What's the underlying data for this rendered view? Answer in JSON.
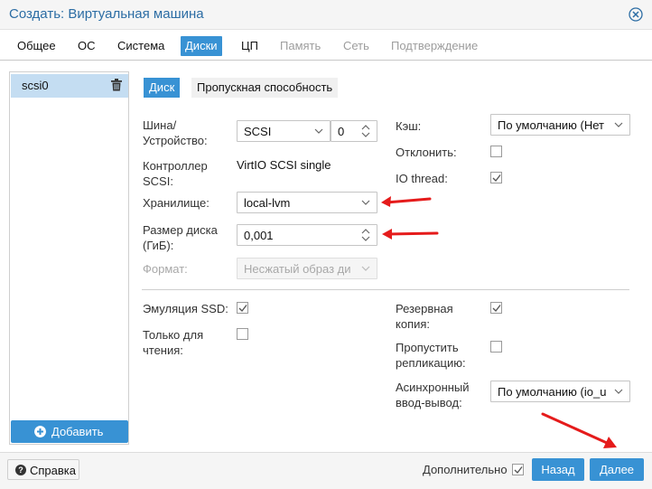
{
  "window": {
    "title": "Создать: Виртуальная машина"
  },
  "tabs": [
    {
      "label": "Общее",
      "state": "normal"
    },
    {
      "label": "ОС",
      "state": "normal"
    },
    {
      "label": "Система",
      "state": "normal"
    },
    {
      "label": "Диски",
      "state": "active"
    },
    {
      "label": "ЦП",
      "state": "normal"
    },
    {
      "label": "Память",
      "state": "disabled"
    },
    {
      "label": "Сеть",
      "state": "disabled"
    },
    {
      "label": "Подтверждение",
      "state": "disabled"
    }
  ],
  "disk_list": {
    "items": [
      {
        "label": "scsi0"
      }
    ],
    "add_label": "Добавить"
  },
  "subtabs": {
    "disk": "Диск",
    "bandwidth": "Пропускная способность"
  },
  "form": {
    "bus_label": "Шина/\nУстройство:",
    "bus_value": "SCSI",
    "device_value": "0",
    "controller_label": "Контроллер\nSCSI:",
    "controller_value": "VirtIO SCSI single",
    "storage_label": "Хранилище:",
    "storage_value": "local-lvm",
    "size_label": "Размер диска\n(ГиБ):",
    "size_value": "0,001",
    "format_label": "Формат:",
    "format_value": "Несжатый образ ди",
    "cache_label": "Кэш:",
    "cache_value": "По умолчанию (Нет",
    "discard_label": "Отклонить:",
    "discard_checked": false,
    "iothread_label": "IO thread:",
    "iothread_checked": true,
    "ssd_label": "Эмуляция SSD:",
    "ssd_checked": true,
    "readonly_label": "Только для\nчтения:",
    "readonly_checked": false,
    "backup_label": "Резервная\nкопия:",
    "backup_checked": true,
    "skip_repl_label": "Пропустить\nрепликацию:",
    "skip_repl_checked": false,
    "async_label": "Асинхронный\nввод-вывод:",
    "async_value": "По умолчанию (io_u"
  },
  "footer": {
    "help_label": "Справка",
    "advanced_label": "Дополнительно",
    "advanced_checked": true,
    "back_label": "Назад",
    "next_label": "Далее"
  },
  "colors": {
    "accent": "#3892d4",
    "title": "#2c6da4",
    "annotation_arrow": "#e51b1b"
  }
}
